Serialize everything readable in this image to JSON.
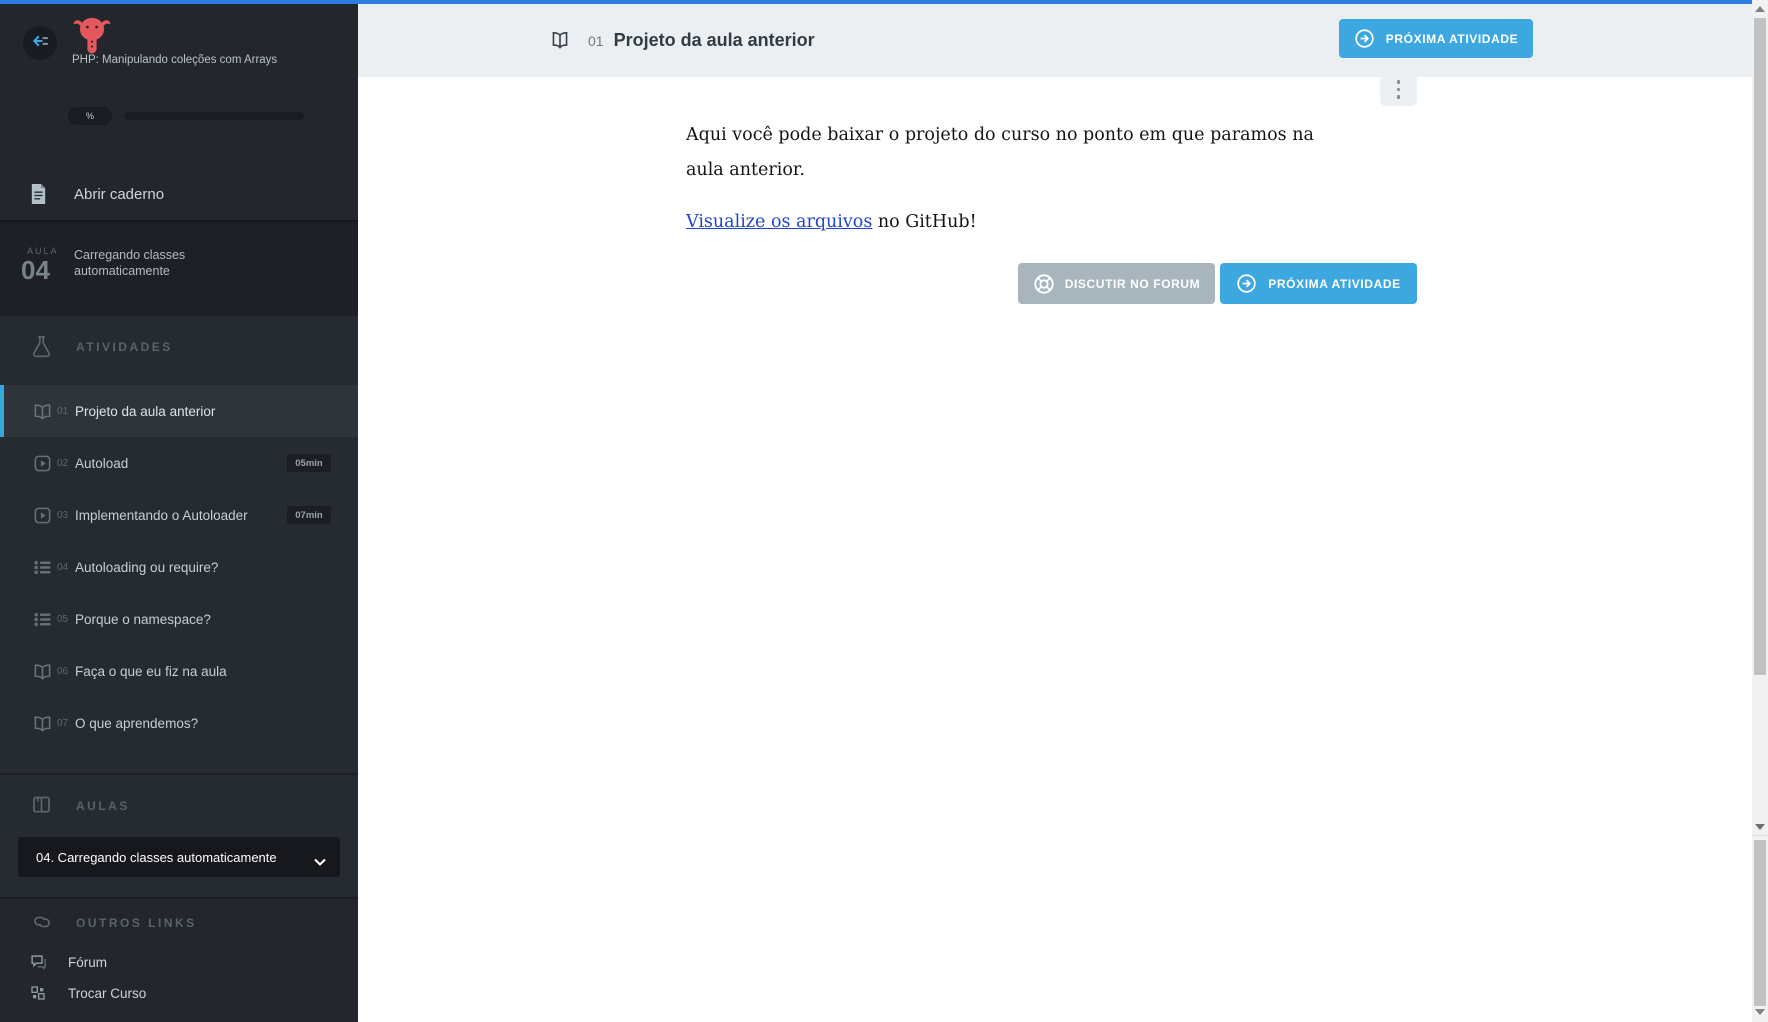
{
  "colors": {
    "topbar_blue": "#2b7de0",
    "accent_blue": "#3da8e0",
    "brand_red": "#e4575c",
    "link_blue": "#2146c7",
    "forum_button_gray": "#a8b5bd",
    "sidebar_bg": "#23272d"
  },
  "sidebar": {
    "course_title": "PHP: Manipulando coleções com Arrays",
    "progress_percent_label": "%",
    "open_notebook_label": "Abrir caderno",
    "current_lesson": {
      "label": "AULA",
      "number": "04",
      "title": "Carregando classes automaticamente"
    },
    "activities_header": "ATIVIDADES",
    "activities": [
      {
        "num": "01",
        "label": "Projeto da aula anterior",
        "icon": "book-open",
        "duration": "",
        "active": true
      },
      {
        "num": "02",
        "label": "Autoload",
        "icon": "video",
        "duration": "05min",
        "active": false
      },
      {
        "num": "03",
        "label": "Implementando o Autoloader",
        "icon": "video",
        "duration": "07min",
        "active": false
      },
      {
        "num": "04",
        "label": "Autoloading ou require?",
        "icon": "list",
        "duration": "",
        "active": false
      },
      {
        "num": "05",
        "label": "Porque o namespace?",
        "icon": "list",
        "duration": "",
        "active": false
      },
      {
        "num": "06",
        "label": "Faça o que eu fiz na aula",
        "icon": "book-open",
        "duration": "",
        "active": false
      },
      {
        "num": "07",
        "label": "O que aprendemos?",
        "icon": "book-open",
        "duration": "",
        "active": false
      }
    ],
    "lessons_header": "AULAS",
    "lesson_select_value": "04. Carregando classes automaticamente",
    "other_links_header": "OUTROS LINKS",
    "links": [
      {
        "label": "Fórum",
        "icon": "chat"
      },
      {
        "label": "Trocar Curso",
        "icon": "grid"
      }
    ]
  },
  "header": {
    "activity_number": "01",
    "title": "Projeto da aula anterior",
    "next_button_label": "PRÓXIMA ATIVIDADE"
  },
  "content": {
    "paragraph": "Aqui você pode baixar o projeto do curso no ponto em que paramos na aula anterior.",
    "link_text": "Visualize os arquivos",
    "link_suffix": " no GitHub!",
    "forum_button_label": "DISCUTIR NO FORUM",
    "next_button_label": "PRÓXIMA ATIVIDADE"
  }
}
